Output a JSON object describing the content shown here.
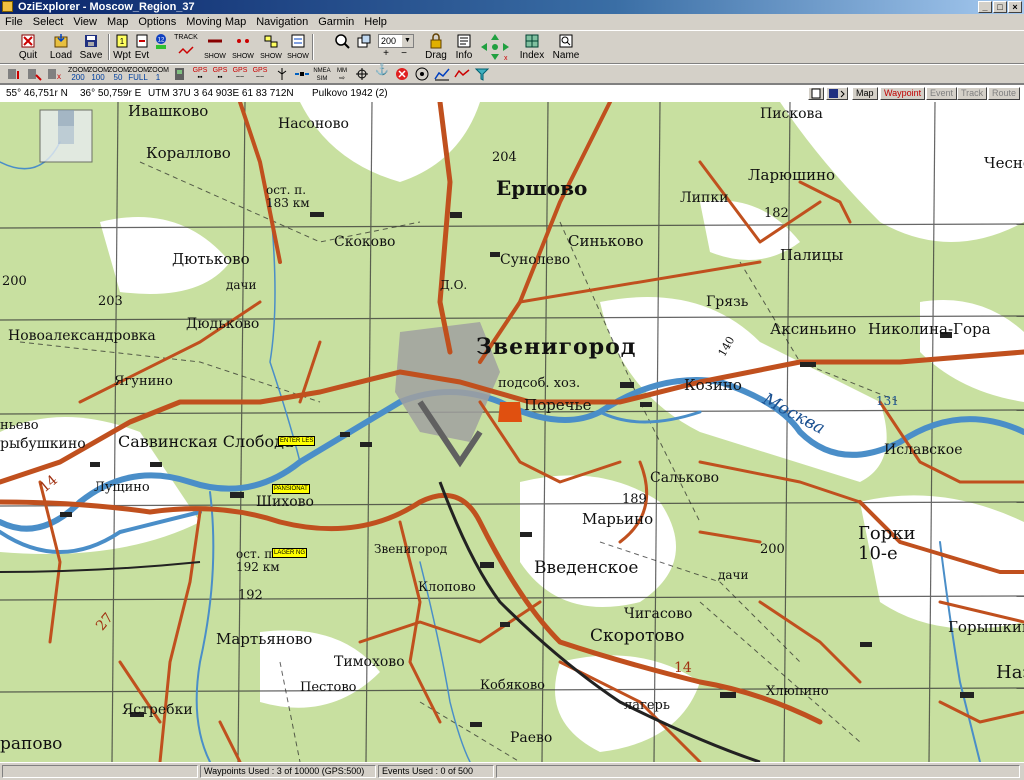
{
  "window": {
    "title": "OziExplorer - Moscow_Region_37",
    "controls": [
      "_",
      "□",
      "×"
    ]
  },
  "menu": [
    "File",
    "Select",
    "View",
    "Map",
    "Options",
    "Moving Map",
    "Navigation",
    "Garmin",
    "Help"
  ],
  "toolbar": {
    "quit": "Quit",
    "load": "Load",
    "save": "Save",
    "wpt": "Wpt",
    "evt": "Evt",
    "track_show": "SHOW",
    "track_label": "TRACK",
    "zoom_value": "200",
    "drag": "Drag",
    "info": "Info",
    "index": "Index",
    "name": "Name"
  },
  "toolbar2": {
    "zoom_buttons": [
      {
        "top": "ZOOM",
        "bottom": "200"
      },
      {
        "top": "ZOOM",
        "bottom": "100"
      },
      {
        "top": "ZOOM",
        "bottom": "50"
      },
      {
        "top": "ZOOM",
        "bottom": "FULL"
      },
      {
        "top": "ZOOM",
        "bottom": "1"
      }
    ],
    "gps_buttons": [
      "GPS",
      "GPS",
      "GPS",
      "GPS"
    ],
    "nmea": "NMEA",
    "mm": "MM"
  },
  "coords": {
    "lat": "55° 46,751r N",
    "lon": "36° 50,759r E",
    "utm": "UTM  37U    3 64 903E    61 83 712N",
    "datum": "Pulkovo 1942 (2)"
  },
  "view_tabs": [
    "Map",
    "Waypoint",
    "Event",
    "Track",
    "Route"
  ],
  "map_labels": [
    "Ивашково",
    "Насоново",
    "Кораллово",
    "Ершово",
    "Липки",
    "Пискова",
    "Ларюшино",
    "Чесно",
    "Скоково",
    "Сунолево",
    "Синьково",
    "Палицы",
    "Дютьково",
    "дачи",
    "Дюдьково",
    "Грязь",
    "Новоалександровка",
    "Звенигород",
    "Аксиньино",
    "Николина-Гора",
    "Козино",
    "Поречье",
    "подсоб. хоз.",
    "Ягунино",
    "Саввинская Слобода",
    "Лущино",
    "Шихово",
    "Москва",
    "Иславское",
    "Сальково",
    "Марьино",
    "Введенское",
    "Звенигород",
    "Клопово",
    "Чигасово",
    "Скоротово",
    "Горки 10-е",
    "Горышкино",
    "Мартьяново",
    "Тимохово",
    "Кобяково",
    "Пестово",
    "Ястребки",
    "Хлюпино",
    "Раево",
    "лагерь",
    "ост. п. 183 км",
    "ост. п. 192 км",
    "Д.О.",
    "Наз",
    "рапово",
    "дачи",
    "ньево",
    "рыбушкино"
  ],
  "map_numbers": [
    "204",
    "182",
    "200",
    "203",
    "189",
    "200",
    "192",
    "131",
    "14",
    "14",
    "27",
    "140"
  ],
  "waypoints": [
    "ENTER LES",
    "PANSIONAT",
    "LAGER NG"
  ],
  "status": {
    "waypoints": "Waypoints Used : 3 of 10000  (GPS:500)",
    "events": "Events Used : 0 of 500"
  },
  "colors": {
    "forest": "#c8e0a0",
    "road": "#c0501e",
    "river": "#4a8ec8",
    "titlebar": "#0a246a",
    "waypoint": "#ffff00"
  }
}
